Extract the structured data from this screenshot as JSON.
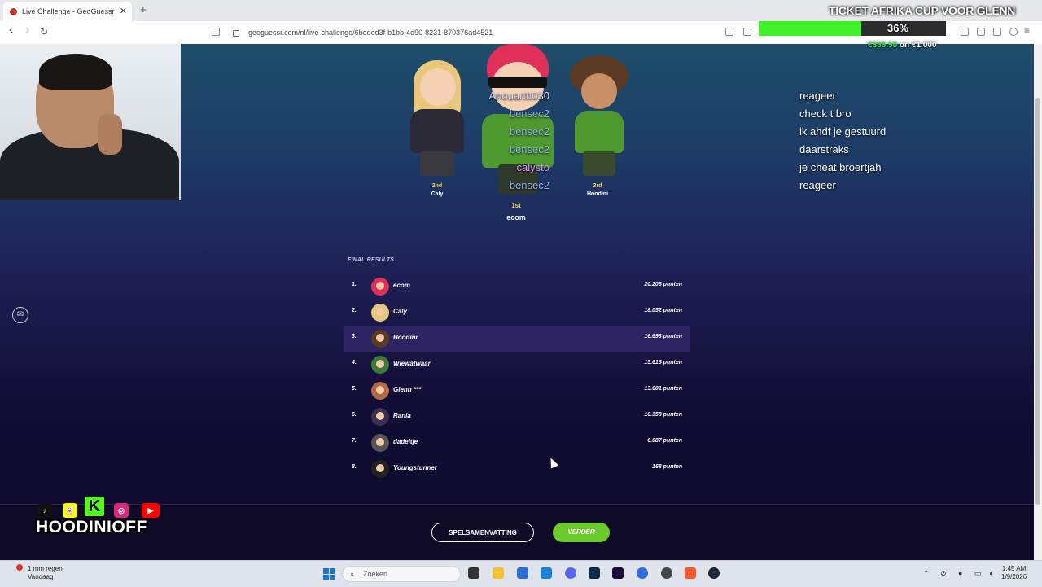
{
  "browser": {
    "tab_title": "Live Challenge - GeoGuessr",
    "tab_close": "✕",
    "new_tab": "+",
    "back": "‹",
    "forward": "›",
    "reload": "↻",
    "url": "geoguessr.com/nl/live-challenge/6beded3f-b1bb-4d90-8231-870376ad4521",
    "minimize": "–",
    "maximize": "□"
  },
  "overlay": {
    "ticket_title": "TICKET AFRIKA CUP VOOR GLENN",
    "progress_pct": "36%",
    "progress_fraction": 0.36,
    "amount_raised": "€366.50",
    "amount_sep": " on ",
    "amount_goal": "€1,000",
    "handle": "HOODINIOFF",
    "socials": [
      "tiktok-icon",
      "snapchat-icon",
      "kick-icon",
      "instagram-icon",
      "youtube-icon"
    ],
    "social_glyphs": [
      "♪",
      "👻",
      "K",
      "◎",
      "▶"
    ]
  },
  "podium": {
    "second": {
      "place": "2nd",
      "name": "Caly"
    },
    "first": {
      "place": "1st",
      "name": "ecom"
    },
    "third": {
      "place": "3rd",
      "name": "Hoodini"
    }
  },
  "chat": [
    {
      "user": "Anouarttt030",
      "msg": "reageer",
      "color": "#d7d3f2"
    },
    {
      "user": "bensec2",
      "msg": "check t bro",
      "color": "#8fb1f0"
    },
    {
      "user": "bensec2",
      "msg": "ik ahdf je gestuurd",
      "color": "#8fb1f0"
    },
    {
      "user": "bensec2",
      "msg": "daarstraks",
      "color": "#8fb1f0"
    },
    {
      "user": "calysto",
      "msg": "je cheat broertjah",
      "color": "#d79af2"
    },
    {
      "user": "bensec2",
      "msg": "reageer",
      "color": "#8fb1f0"
    }
  ],
  "results": {
    "title": "FINAL RESULTS",
    "rows": [
      {
        "rank": "1.",
        "name": "ecom",
        "points": "20.206 punten"
      },
      {
        "rank": "2.",
        "name": "Caly",
        "points": "18.052 punten"
      },
      {
        "rank": "3.",
        "name": "Hoodini",
        "points": "16.693 punten"
      },
      {
        "rank": "4.",
        "name": "Wiewatwaar",
        "points": "15.616 punten"
      },
      {
        "rank": "5.",
        "name": "Glenn ***",
        "points": "13.601 punten"
      },
      {
        "rank": "6.",
        "name": "Rania",
        "points": "10.358 punten"
      },
      {
        "rank": "7.",
        "name": "dadeltje",
        "points": "6.087 punten"
      },
      {
        "rank": "8.",
        "name": "Youngstunner",
        "points": "168 punten"
      }
    ],
    "highlighted_rank": "3."
  },
  "buttons": {
    "summary": "SPELSAMENVATTING",
    "next": "VERDER"
  },
  "taskbar": {
    "weather_line1": "1 mm regen",
    "weather_line2": "Vandaag",
    "search_placeholder": "Zoeken",
    "search_icon": "⌕",
    "time": "1:45 AM",
    "date": "1/9/2026"
  },
  "colors": {
    "accent_green": "#6bcb2a",
    "progress_green": "#3ff02b",
    "highlight_row": "#2f2463"
  }
}
